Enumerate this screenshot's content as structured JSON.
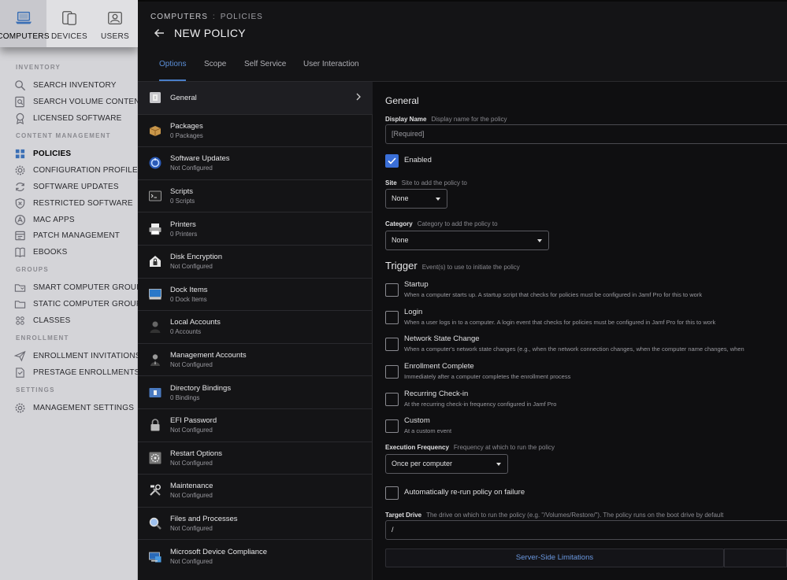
{
  "top_tabs": [
    {
      "label": "COMPUTERS",
      "icon": "laptop-icon",
      "active": true
    },
    {
      "label": "DEVICES",
      "icon": "devices-icon",
      "active": false
    },
    {
      "label": "USERS",
      "icon": "users-icon",
      "active": false
    }
  ],
  "sidebar": {
    "sections": {
      "inventory": "INVENTORY",
      "content": "CONTENT MANAGEMENT",
      "groups": "GROUPS",
      "enrollment": "ENROLLMENT",
      "settings": "SETTINGS"
    },
    "items": {
      "search_inventory": "SEARCH INVENTORY",
      "search_volume": "SEARCH VOLUME CONTENT",
      "licensed_software": "LICENSED SOFTWARE",
      "policies": "POLICIES",
      "config_profiles": "CONFIGURATION PROFILES",
      "software_updates": "SOFTWARE UPDATES",
      "restricted_software": "RESTRICTED SOFTWARE",
      "mac_apps": "MAC APPS",
      "patch_management": "PATCH MANAGEMENT",
      "ebooks": "EBOOKS",
      "smart_groups": "SMART COMPUTER GROUPS",
      "static_groups": "STATIC COMPUTER GROUPS",
      "classes": "CLASSES",
      "enrollment_invitations": "ENROLLMENT INVITATIONS",
      "prestage_enrollments": "PRESTAGE ENROLLMENTS",
      "management_settings": "MANAGEMENT SETTINGS"
    }
  },
  "header": {
    "breadcrumb_root": "COMPUTERS",
    "breadcrumb_sep": ":",
    "breadcrumb_current": "POLICIES",
    "title": "NEW POLICY"
  },
  "tabs": [
    "Options",
    "Scope",
    "Self Service",
    "User Interaction"
  ],
  "payloads": [
    {
      "name": "General",
      "sub": "",
      "icon": "general-icon",
      "color": "#c8c8cc"
    },
    {
      "name": "Packages",
      "sub": "0 Packages",
      "icon": "package-icon",
      "color": "#c8964a"
    },
    {
      "name": "Software Updates",
      "sub": "Not Configured",
      "icon": "software-update-icon",
      "color": "#4a8ad8"
    },
    {
      "name": "Scripts",
      "sub": "0 Scripts",
      "icon": "terminal-icon",
      "color": "#aaaaaa"
    },
    {
      "name": "Printers",
      "sub": "0 Printers",
      "icon": "printer-icon",
      "color": "#dddddd"
    },
    {
      "name": "Disk Encryption",
      "sub": "Not Configured",
      "icon": "disk-encryption-icon",
      "color": "#e0e0e0"
    },
    {
      "name": "Dock Items",
      "sub": "0 Dock Items",
      "icon": "dock-icon",
      "color": "#4a9ae0"
    },
    {
      "name": "Local Accounts",
      "sub": "0 Accounts",
      "icon": "local-account-icon",
      "color": "#888888"
    },
    {
      "name": "Management Accounts",
      "sub": "Not Configured",
      "icon": "management-account-icon",
      "color": "#888888"
    },
    {
      "name": "Directory Bindings",
      "sub": "0 Bindings",
      "icon": "directory-icon",
      "color": "#5a8ad0"
    },
    {
      "name": "EFI Password",
      "sub": "Not Configured",
      "icon": "lock-icon",
      "color": "#aaaaaa"
    },
    {
      "name": "Restart Options",
      "sub": "Not Configured",
      "icon": "restart-icon",
      "color": "#999999"
    },
    {
      "name": "Maintenance",
      "sub": "Not Configured",
      "icon": "tools-icon",
      "color": "#bbbbbb"
    },
    {
      "name": "Files and Processes",
      "sub": "Not Configured",
      "icon": "magnifier-icon",
      "color": "#8ab0e0"
    },
    {
      "name": "Microsoft Device Compliance",
      "sub": "Not Configured",
      "icon": "compliance-icon",
      "color": "#4a90d8"
    }
  ],
  "form": {
    "heading": "General",
    "display_name_label": "Display Name",
    "display_name_hint": "Display name for the policy",
    "display_name_placeholder": "[Required]",
    "enabled_label": "Enabled",
    "site_label": "Site",
    "site_hint": "Site to add the policy to",
    "site_value": "None",
    "category_label": "Category",
    "category_hint": "Category to add the policy to",
    "category_value": "None",
    "trigger_label": "Trigger",
    "trigger_hint": "Event(s) to use to initiate the policy",
    "triggers": [
      {
        "title": "Startup",
        "desc": "When a computer starts up. A startup script that checks for policies must be configured in Jamf Pro for this to work"
      },
      {
        "title": "Login",
        "desc": "When a user logs in to a computer. A login event that checks for policies must be configured in Jamf Pro for this to work"
      },
      {
        "title": "Network State Change",
        "desc": "When a computer's network state changes (e.g., when the network connection changes, when the computer name changes, when"
      },
      {
        "title": "Enrollment Complete",
        "desc": "Immediately after a computer completes the enrollment process"
      },
      {
        "title": "Recurring Check-in",
        "desc": "At the recurring check-in frequency configured in Jamf Pro"
      },
      {
        "title": "Custom",
        "desc": "At a custom event"
      }
    ],
    "exec_freq_label": "Execution Frequency",
    "exec_freq_hint": "Frequency at which to run the policy",
    "exec_freq_value": "Once per computer",
    "rerun_label": "Automatically re-run policy on failure",
    "target_drive_label": "Target Drive",
    "target_drive_hint": "The drive on which to run the policy (e.g. \"/Volumes/Restore/\"). The policy runs on the boot drive by default",
    "target_drive_value": "/",
    "ssl_button": "Server-Side Limitations"
  },
  "colors": {
    "accent": "#3a6fd8",
    "link": "#6a98e0",
    "sidebar_bg": "#d4d4d8",
    "main_bg": "#141416"
  }
}
